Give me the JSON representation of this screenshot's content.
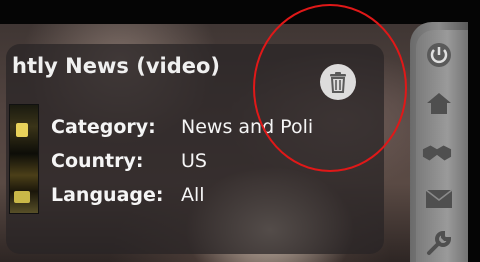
{
  "widget": {
    "title": "htly News (video)",
    "details": [
      {
        "key": "Category:",
        "value": "News and Poli"
      },
      {
        "key": "Country:",
        "value": "US"
      },
      {
        "key": "Language:",
        "value": "All"
      }
    ]
  },
  "icons": {
    "delete": "trash-icon",
    "sidebar": [
      "power-icon",
      "home-icon",
      "handshake-icon",
      "mail-icon",
      "wrench-icon"
    ]
  },
  "colors": {
    "highlight_ring": "#e01818",
    "sidebar": "#8a8a8a"
  }
}
